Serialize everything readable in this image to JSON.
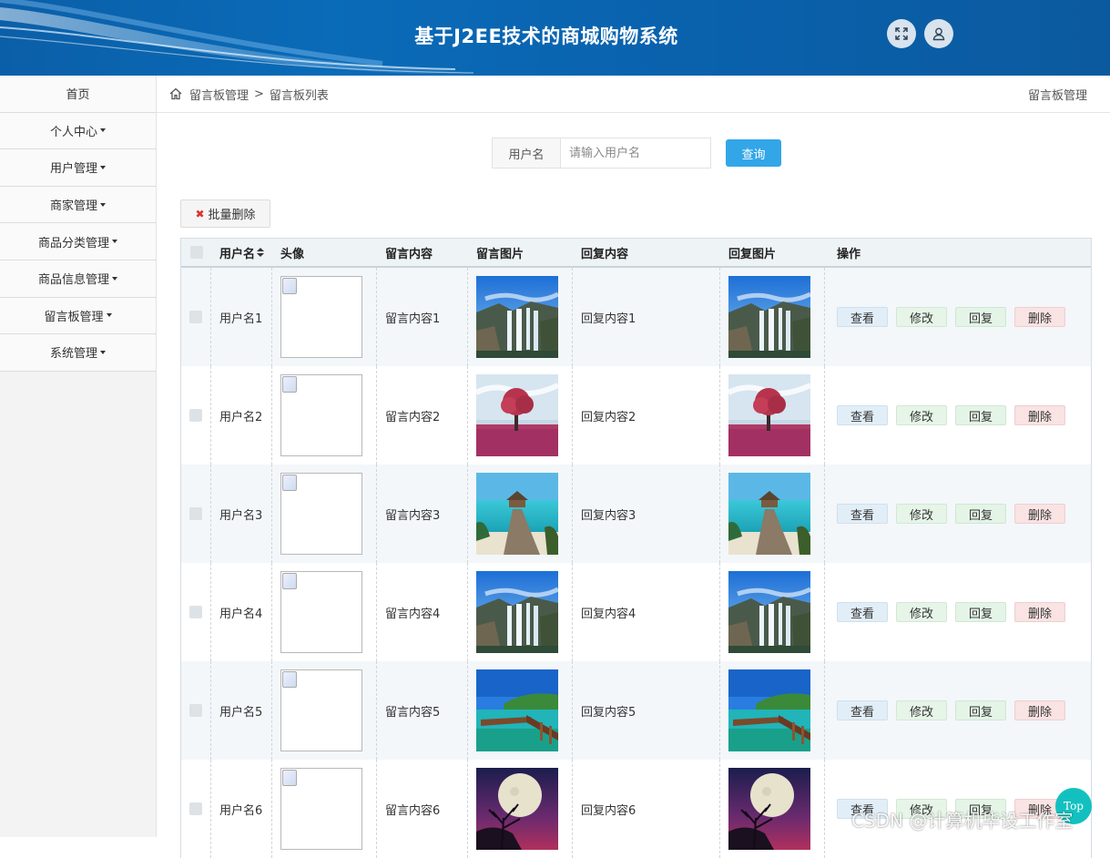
{
  "header": {
    "title": "基于J2EE技术的商城购物系统",
    "icons": [
      "fullscreen-icon",
      "user-icon"
    ]
  },
  "sidebar": {
    "items": [
      {
        "label": "首页",
        "has_caret": false
      },
      {
        "label": "个人中心",
        "has_caret": true
      },
      {
        "label": "用户管理",
        "has_caret": true
      },
      {
        "label": "商家管理",
        "has_caret": true
      },
      {
        "label": "商品分类管理",
        "has_caret": true
      },
      {
        "label": "商品信息管理",
        "has_caret": true
      },
      {
        "label": "留言板管理",
        "has_caret": true
      },
      {
        "label": "系统管理",
        "has_caret": true
      }
    ]
  },
  "breadcrumb": {
    "items": [
      "留言板管理",
      "留言板列表"
    ],
    "separator": ">",
    "right_title": "留言板管理"
  },
  "search": {
    "label": "用户名",
    "placeholder": "请输入用户名",
    "button": "查询"
  },
  "toolbar": {
    "batch_delete": "批量删除"
  },
  "table": {
    "columns": [
      "",
      "用户名",
      "头像",
      "留言内容",
      "留言图片",
      "回复内容",
      "回复图片",
      "操作"
    ],
    "actions": {
      "view": "查看",
      "edit": "修改",
      "reply": "回复",
      "delete": "删除"
    },
    "rows": [
      {
        "username": "用户名1",
        "content": "留言内容1",
        "reply": "回复内容1",
        "image": "waterfall"
      },
      {
        "username": "用户名2",
        "content": "留言内容2",
        "reply": "回复内容2",
        "image": "pink-tree"
      },
      {
        "username": "用户名3",
        "content": "留言内容3",
        "reply": "回复内容3",
        "image": "beach-hut"
      },
      {
        "username": "用户名4",
        "content": "留言内容4",
        "reply": "回复内容4",
        "image": "waterfall"
      },
      {
        "username": "用户名5",
        "content": "留言内容5",
        "reply": "回复内容5",
        "image": "pier-lake"
      },
      {
        "username": "用户名6",
        "content": "留言内容6",
        "reply": "回复内容6",
        "image": "moon-tree"
      }
    ]
  },
  "floating": {
    "top_button": "Top",
    "watermark": "CSDN @计算机毕设工作室"
  },
  "colors": {
    "header_bg": "#0a64ae",
    "query_button": "#33a6e8",
    "top_button": "#12c1bf",
    "delete_x": "#d9332d"
  }
}
